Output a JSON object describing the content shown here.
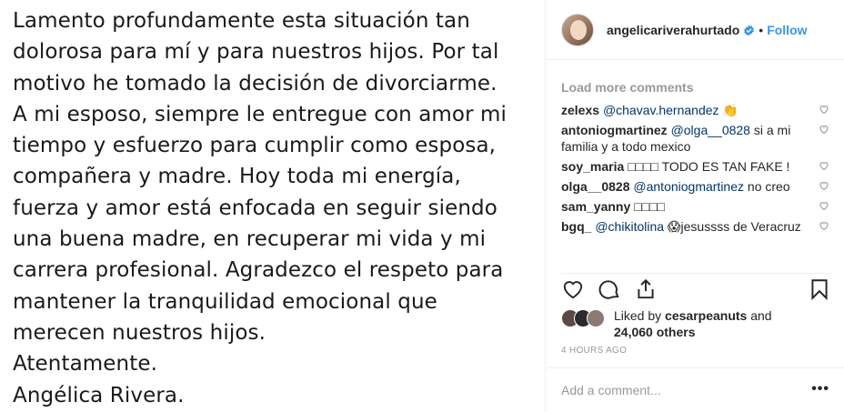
{
  "statement": {
    "lines": [
      "Lamento profundamente esta situación tan",
      "dolorosa para mí y para nuestros hijos. Por tal",
      "motivo he tomado la decisión de divorciarme.",
      "A mi esposo, siempre le entregue con amor mi",
      "tiempo y esfuerzo para cumplir como esposa,",
      "compañera y madre. Hoy toda mi energía,",
      "fuerza y amor está enfocada en seguir siendo",
      "una buena madre, en recuperar mi vida y mi",
      "carrera profesional. Agradezco el respeto para",
      "mantener la tranquilidad emocional que",
      "merecen nuestros hijos.",
      "Atentamente.",
      "Angélica Rivera."
    ]
  },
  "header": {
    "username": "angelicariverahurtado",
    "separator": "•",
    "follow_label": "Follow"
  },
  "comments": {
    "load_more": "Load more comments",
    "items": [
      {
        "user": "zelexs",
        "mention": "@chavav.hernandez",
        "text": " 👏"
      },
      {
        "user": "antoniogmartinez",
        "mention": "@olga__0828",
        "text": " si a mi familia y a todo mexico"
      },
      {
        "user": "soy_maria",
        "mention": "",
        "text": "□□□□ TODO ES TAN FAKE !"
      },
      {
        "user": "olga__0828",
        "mention": "@antoniogmartinez",
        "text": " no creo"
      },
      {
        "user": "sam_yanny",
        "mention": "",
        "text": "□□□□"
      },
      {
        "user": "bgq_",
        "mention": "@chikitolina",
        "text": " 😱jesussss de Veracruz"
      }
    ]
  },
  "likes": {
    "prefix": "Liked by ",
    "user": "cesarpeanuts",
    "middle": " and ",
    "count": "24,060 others"
  },
  "timestamp": "4 HOURS AGO",
  "add_comment": {
    "placeholder": "Add a comment...",
    "more_label": "•••"
  },
  "colors": {
    "link_blue": "#3897f0",
    "mention": "#003569",
    "muted": "#999999"
  },
  "icons": [
    "verified-badge-icon",
    "heart-icon",
    "comment-icon",
    "share-icon",
    "bookmark-icon",
    "more-options-icon"
  ]
}
